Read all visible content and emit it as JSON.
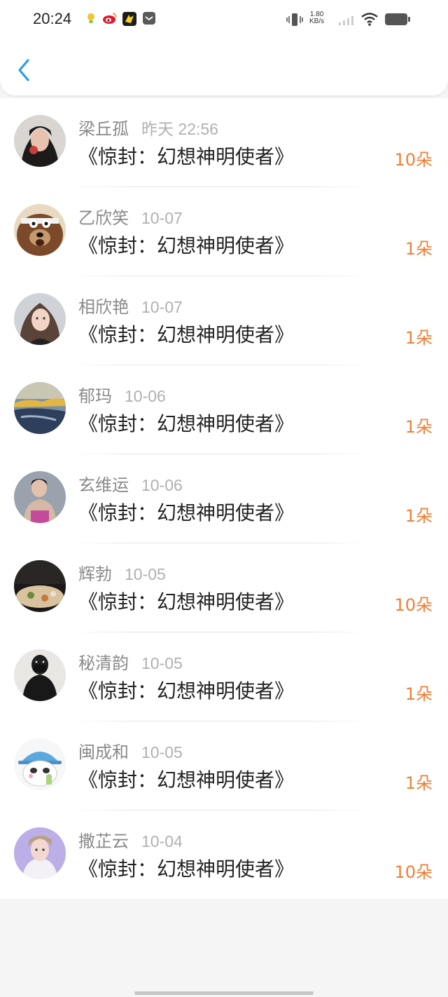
{
  "status_bar": {
    "time": "20:24",
    "net_speed_value": "1.80",
    "net_speed_unit": "KB/s",
    "left_icons": [
      "lightbulb-icon",
      "weibo-icon",
      "game-icon",
      "mail-icon"
    ],
    "right_icons": [
      "vibrate-icon",
      "signal-icon",
      "wifi-icon",
      "battery-icon"
    ]
  },
  "header": {
    "back_icon": "chevron-left-icon",
    "accent_color": "#2c9bea"
  },
  "list": {
    "count_color": "#ef7f35",
    "items": [
      {
        "name": "梁丘孤",
        "time": "昨天 22:56",
        "gift": "《惊封：幻想神明使者》",
        "count": "10朵",
        "avatar": "portrait-photo"
      },
      {
        "name": "乙欣笑",
        "time": "10-07",
        "gift": "《惊封：幻想神明使者》",
        "count": "1朵",
        "avatar": "cartoon-bear"
      },
      {
        "name": "相欣艳",
        "time": "10-07",
        "gift": "《惊封：幻想神明使者》",
        "count": "1朵",
        "avatar": "portrait-photo"
      },
      {
        "name": "郁玛",
        "time": "10-06",
        "gift": "《惊封：幻想神明使者》",
        "count": "1朵",
        "avatar": "landscape-photo"
      },
      {
        "name": "玄维运",
        "time": "10-06",
        "gift": "《惊封：幻想神明使者》",
        "count": "1朵",
        "avatar": "portrait-photo"
      },
      {
        "name": "辉勃",
        "time": "10-05",
        "gift": "《惊封：幻想神明使者》",
        "count": "10朵",
        "avatar": "food-photo"
      },
      {
        "name": "秘清韵",
        "time": "10-05",
        "gift": "《惊封：幻想神明使者》",
        "count": "1朵",
        "avatar": "portrait-photo"
      },
      {
        "name": "闽成和",
        "time": "10-05",
        "gift": "《惊封：幻想神明使者》",
        "count": "1朵",
        "avatar": "cartoon-panda"
      },
      {
        "name": "撒芷云",
        "time": "10-04",
        "gift": "《惊封：幻想神明使者》",
        "count": "10朵",
        "avatar": "portrait-photo"
      }
    ]
  }
}
